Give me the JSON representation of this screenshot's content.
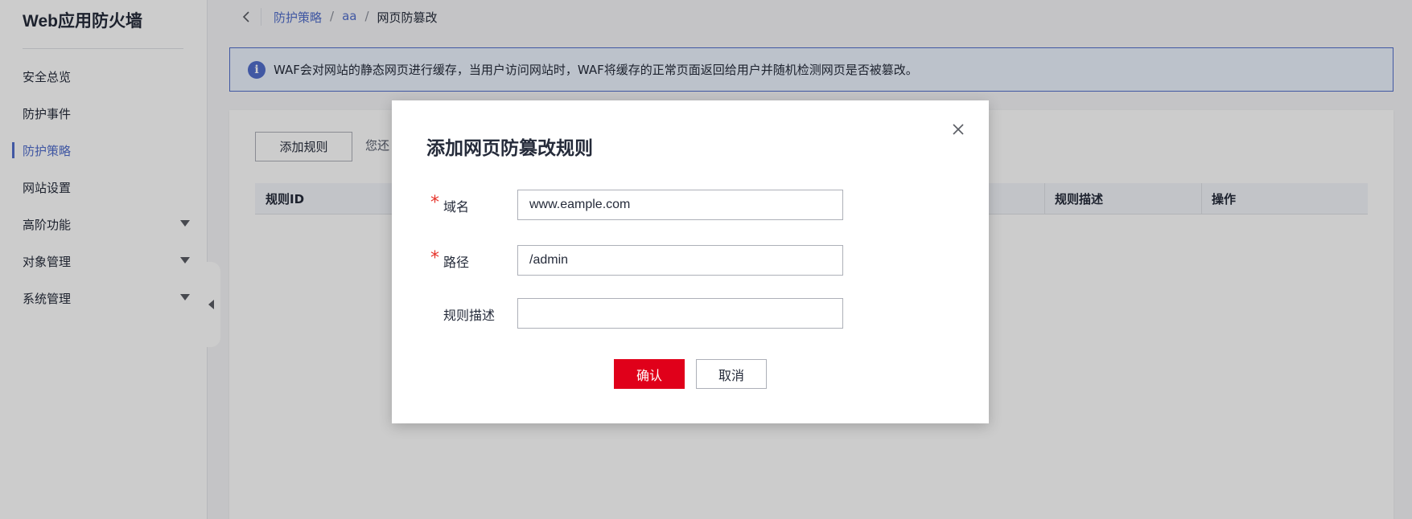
{
  "sidebar": {
    "app_title": "Web应用防火墙",
    "items": [
      {
        "label": "安全总览",
        "active": false,
        "expandable": false
      },
      {
        "label": "防护事件",
        "active": false,
        "expandable": false
      },
      {
        "label": "防护策略",
        "active": true,
        "expandable": false
      },
      {
        "label": "网站设置",
        "active": false,
        "expandable": false
      },
      {
        "label": "高阶功能",
        "active": false,
        "expandable": true
      },
      {
        "label": "对象管理",
        "active": false,
        "expandable": true
      },
      {
        "label": "系统管理",
        "active": false,
        "expandable": true
      }
    ]
  },
  "breadcrumb": {
    "items": [
      "防护策略",
      "aa"
    ],
    "separator": "/",
    "current": "网页防篡改"
  },
  "info_banner": {
    "icon": "info-icon",
    "text": "WAF会对网站的静态网页进行缓存，当用户访问网站时，WAF将缓存的正常页面返回给用户并随机检测网页是否被篡改。"
  },
  "card": {
    "add_rule_label": "添加规则",
    "hint_text": "您还",
    "table": {
      "columns": [
        "规则ID",
        "规则描述",
        "操作"
      ]
    }
  },
  "dialog": {
    "title": "添加网页防篡改规则",
    "fields": {
      "domain": {
        "label": "域名",
        "required": true,
        "value": "www.eample.com"
      },
      "path": {
        "label": "路径",
        "required": true,
        "value": "/admin"
      },
      "description": {
        "label": "规则描述",
        "required": false,
        "value": ""
      }
    },
    "confirm_label": "确认",
    "cancel_label": "取消"
  },
  "colors": {
    "accent": "#526ecc",
    "danger": "#e0001a",
    "required_star": "#e6332a"
  }
}
